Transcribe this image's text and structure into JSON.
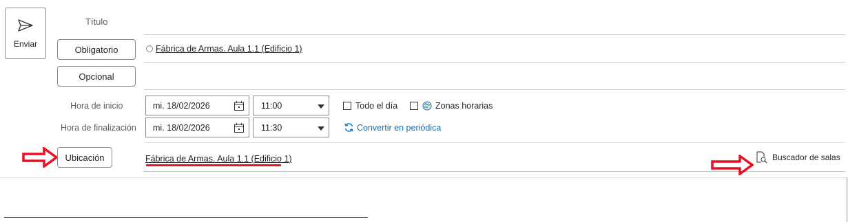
{
  "send": {
    "label": "Enviar",
    "icon": "send-icon"
  },
  "title_field": {
    "placeholder": "Título"
  },
  "attendees": {
    "required_label": "Obligatorio",
    "required_value": "Fábrica de Armas. Aula 1.1 (Edificio 1)",
    "optional_label": "Opcional"
  },
  "schedule": {
    "start_label": "Hora de inicio",
    "end_label": "Hora de finalización",
    "start_date": "mi. 18/02/2026",
    "start_time": "11:00",
    "end_date": "mi. 18/02/2026",
    "end_time": "11:30",
    "all_day_label": "Todo el día",
    "time_zones_label": "Zonas horarias",
    "recurring_label": "Convertir en periódica"
  },
  "location": {
    "button_label": "Ubicación",
    "value": "Fábrica de Armas. Aula 1.1 (Edificio 1)",
    "room_finder_label": "Buscador de salas"
  },
  "colors": {
    "annotation_red": "#e81123",
    "accent_blue": "#0f6cbd"
  }
}
